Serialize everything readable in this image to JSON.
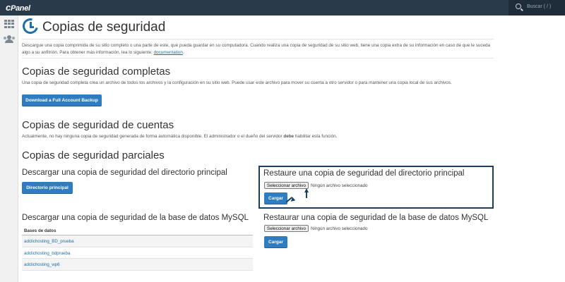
{
  "header": {
    "logo_main": "c",
    "logo_rest": "Panel",
    "search_placeholder": "Buscar ( / )"
  },
  "sidebar": {
    "icons": [
      "grid-icon",
      "users-icon"
    ]
  },
  "page": {
    "title": "Copias de seguridad",
    "description": "Descargue una copia comprimida de su sitio completo o una parte de este, que pueda guardar en su computadora. Cuando realiza una copia de seguridad de su sitio web, tiene una copia extra de su información en caso de que le suceda algo a su anfitrión. Para obtener más información, lea lo siguiente:",
    "description_link": "documentation",
    "description_end": "."
  },
  "full_backup": {
    "heading": "Copias de seguridad completas",
    "text": "Una copia de seguridad completa crea un archivo de todos los archivos y la configuración en su sitio web. Puede usar este archivo para mover su cuenta a otro servidor o para mantener una copia local de sus archivos.",
    "button": "Download a Full Account Backup"
  },
  "account_backup": {
    "heading": "Copias de seguridad de cuentas",
    "text_before": "Actualmente, no hay ninguna copia de seguridad generada de forma automática disponible. El administrador o el dueño del servidor",
    "text_bold": "debe",
    "text_after": "habilitar esta función."
  },
  "partial": {
    "heading": "Copias de seguridad parciales",
    "download_home": {
      "heading": "Descargar una copia de seguridad del directorio principal",
      "button": "Directorio principal"
    },
    "restore_home": {
      "heading": "Restaure una copia de seguridad del directorio principal",
      "file_button": "Seleccionar archivo",
      "no_file": "Ningún archivo seleccionado",
      "upload_button": "Cargar"
    },
    "download_mysql": {
      "heading": "Descargar una copia de seguridad de la base de datos MySQL",
      "column": "Bases de datos",
      "databases": [
        "adclichosting_BD_prueba",
        "adclichosting_bdprueba",
        "adclichosting_wp6"
      ]
    },
    "restore_mysql": {
      "heading": "Restaurar una copia de seguridad de la base de datos MySQL",
      "file_button": "Seleccionar archivo",
      "no_file": "Ningún archivo seleccionado",
      "upload_button": "Cargar"
    }
  },
  "colors": {
    "topbar": "#293a4a",
    "accent": "#2f7dc0",
    "highlight_border": "#1c3f5f"
  }
}
